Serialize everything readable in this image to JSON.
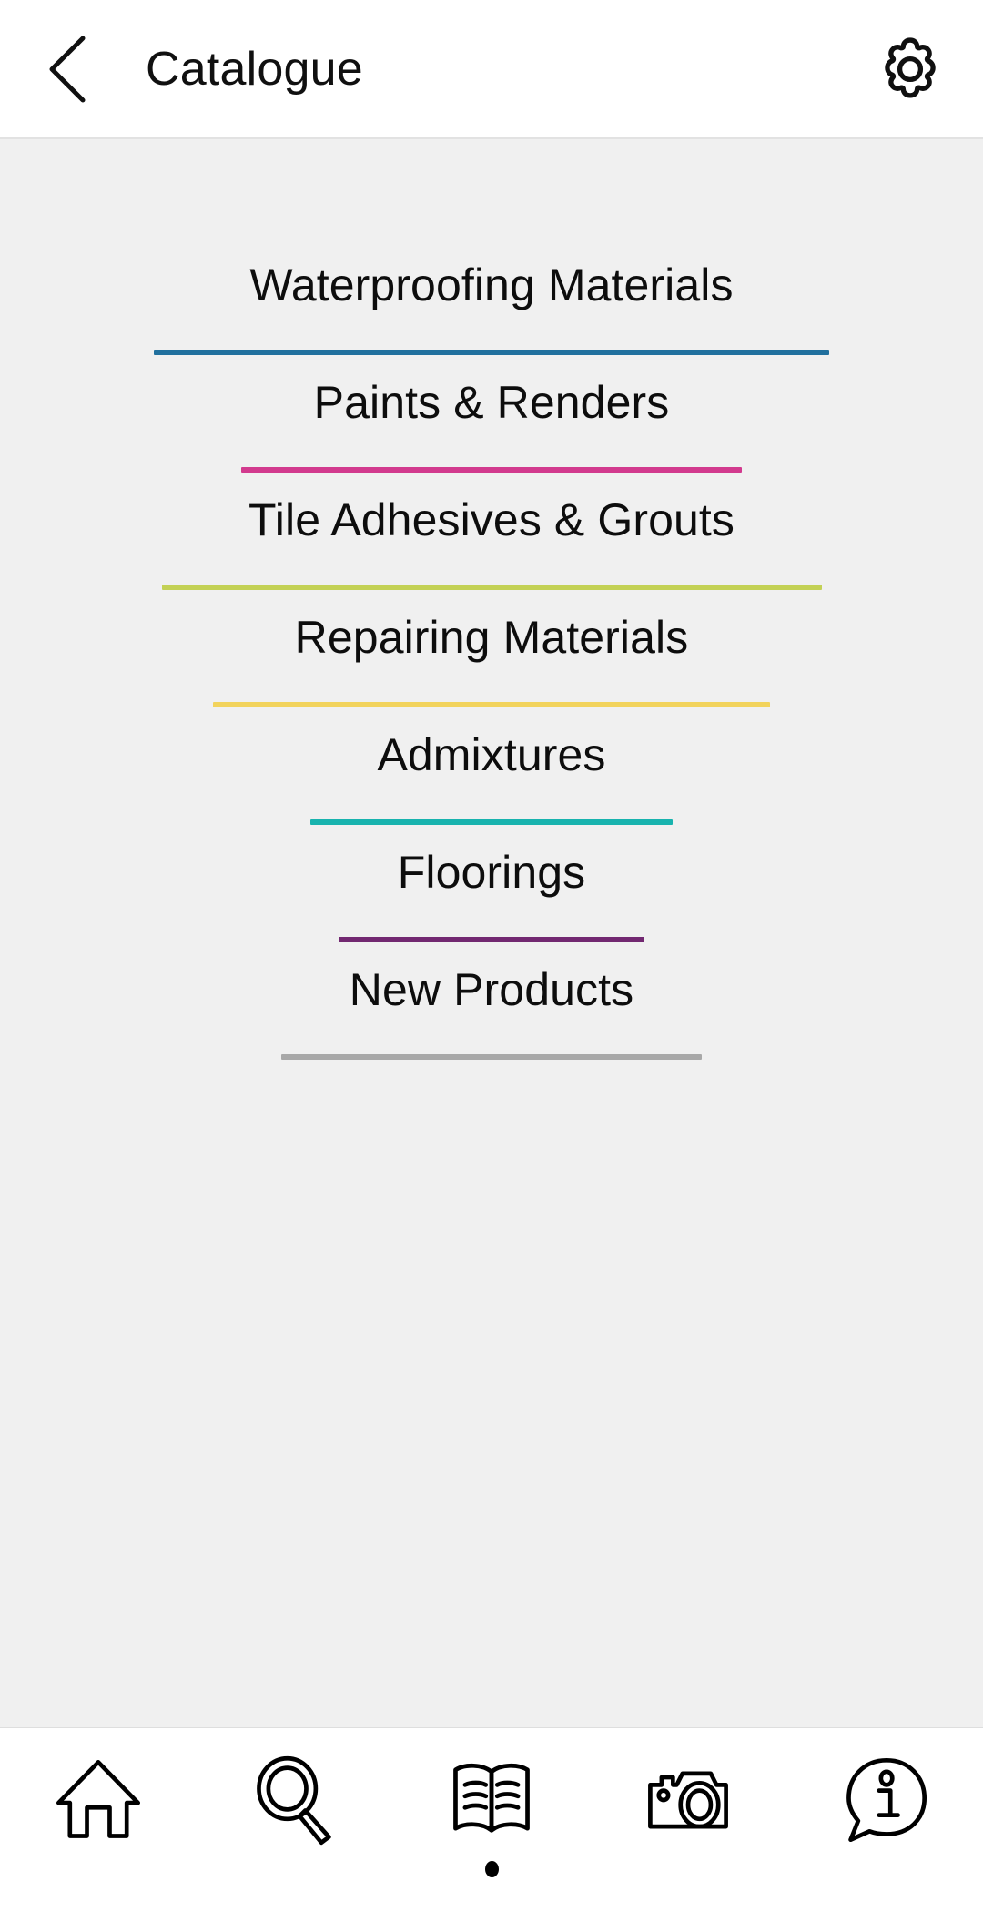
{
  "header": {
    "title": "Catalogue",
    "back_icon": "chevron-left-icon",
    "settings_icon": "gear-icon"
  },
  "categories": [
    {
      "label": "Waterproofing Materials",
      "rule_color": "#21709e",
      "rule_width": 742
    },
    {
      "label": "Paints & Renders",
      "rule_color": "#d23a8e",
      "rule_width": 550
    },
    {
      "label": "Tile Adhesives & Grouts",
      "rule_color": "#c3d155",
      "rule_width": 725
    },
    {
      "label": "Repairing Materials",
      "rule_color": "#f2d35c",
      "rule_width": 612
    },
    {
      "label": "Admixtures",
      "rule_color": "#18b3ae",
      "rule_width": 398
    },
    {
      "label": "Floorings",
      "rule_color": "#722871",
      "rule_width": 336
    },
    {
      "label": "New Products",
      "rule_color": "#a8a8a8",
      "rule_width": 462
    }
  ],
  "bottom_nav": {
    "active_index": 2,
    "items": [
      {
        "icon": "home-icon",
        "label": "Home"
      },
      {
        "icon": "search-icon",
        "label": "Search"
      },
      {
        "icon": "open-book-icon",
        "label": "Catalogue"
      },
      {
        "icon": "camera-icon",
        "label": "Camera"
      },
      {
        "icon": "info-bubble-icon",
        "label": "Info"
      }
    ]
  },
  "colors": {
    "app_background": "#ffffff",
    "content_background": "#f0f0f0",
    "text": "#0d0d0d"
  }
}
